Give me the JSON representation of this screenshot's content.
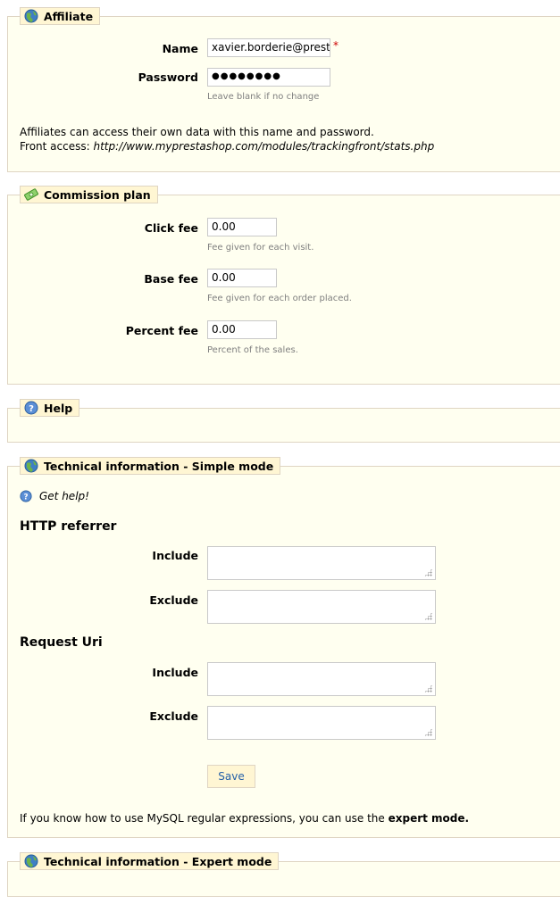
{
  "affiliate": {
    "legend": "Affiliate",
    "name_label": "Name",
    "name_value": "xavier.borderie@presta",
    "required_mark": "*",
    "password_label": "Password",
    "password_value": "●●●●●●●●",
    "password_hint": "Leave blank if no change",
    "info_line1": "Affiliates can access their own data with this name and password.",
    "front_access_label": "Front access:",
    "front_access_url": "http://www.myprestashop.com/modules/trackingfront/stats.php"
  },
  "commission": {
    "legend": "Commission plan",
    "click_fee_label": "Click fee",
    "click_fee_value": "0.00",
    "click_fee_hint": "Fee given for each visit.",
    "base_fee_label": "Base fee",
    "base_fee_value": "0.00",
    "base_fee_hint": "Fee given for each order placed.",
    "percent_fee_label": "Percent fee",
    "percent_fee_value": "0.00",
    "percent_fee_hint": "Percent of the sales."
  },
  "help": {
    "legend": "Help"
  },
  "simple": {
    "legend": "Technical information - Simple mode",
    "get_help": "Get help!",
    "http_referrer_heading": "HTTP referrer",
    "include_label": "Include",
    "exclude_label": "Exclude",
    "request_uri_heading": "Request Uri",
    "save_label": "Save",
    "expert_text": "If you know how to use MySQL regular expressions, you can use the",
    "expert_link": "expert mode."
  },
  "expert": {
    "legend": "Technical information - Expert mode"
  },
  "colors": {
    "panel_bg": "#fffff0",
    "legend_bg": "#fff6d3",
    "border": "#dfd5c3",
    "required": "#cc0000",
    "button_text": "#2661a8"
  }
}
